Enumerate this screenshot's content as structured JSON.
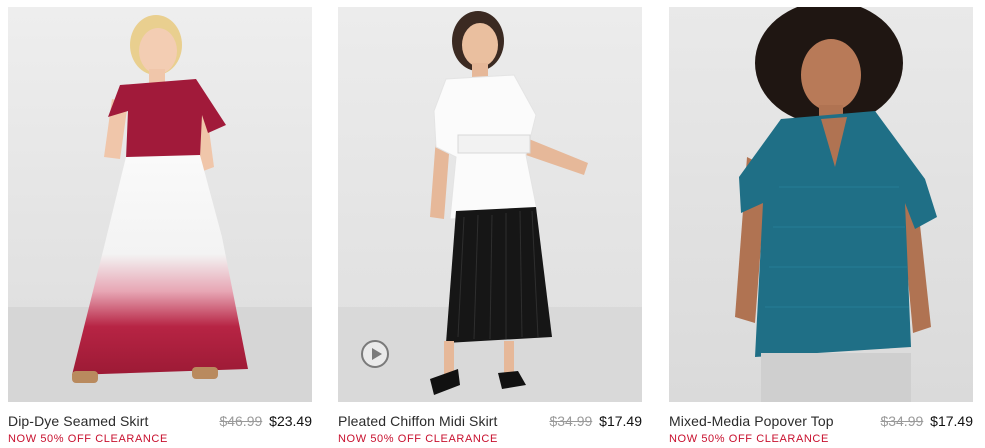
{
  "products": [
    {
      "name": "Dip-Dye Seamed Skirt",
      "original_price": "$46.99",
      "sale_price": "$23.49",
      "promo": "NOW 50% OFF CLEARANCE"
    },
    {
      "name": "Pleated Chiffon Midi Skirt",
      "original_price": "$34.99",
      "sale_price": "$17.49",
      "promo": "NOW 50% OFF CLEARANCE",
      "video_icon": "play-icon"
    },
    {
      "name": "Mixed-Media Popover Top",
      "original_price": "$34.99",
      "sale_price": "$17.49",
      "promo": "NOW 50% OFF CLEARANCE"
    }
  ],
  "colors": {
    "promo_red": "#c8102e",
    "strike_gray": "#9a9a9a",
    "photo_bg": "#e8e8e8"
  }
}
